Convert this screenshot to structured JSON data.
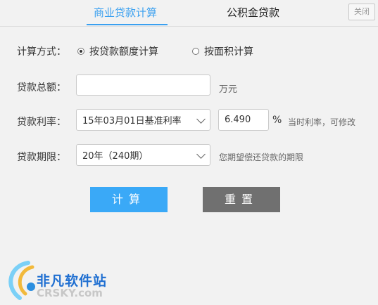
{
  "tabs": {
    "active": "商业贷款计算",
    "inactive": "公积金贷款",
    "close": "关闭"
  },
  "form": {
    "method_label": "计算方式：",
    "method_options": [
      "按贷款额度计算",
      "按面积计算"
    ],
    "method_selected": 0,
    "amount_label": "贷款总额：",
    "amount_value": "",
    "amount_unit": "万元",
    "rate_label": "贷款利率：",
    "rate_select": "15年03月01日基准利率",
    "rate_value": "6.490",
    "rate_unit": "%",
    "rate_hint": "当时利率，可修改",
    "term_label": "贷款期限：",
    "term_select": "20年（240期）",
    "term_hint": "您期望偿还贷款的期限"
  },
  "buttons": {
    "calc": "计算",
    "reset": "重置"
  },
  "watermark": {
    "cn": "非凡软件站",
    "en": "CRSKY.com"
  },
  "colors": {
    "accent": "#3aa0f0",
    "calc_button": "#3aa9f7",
    "reset_button": "#707070"
  }
}
